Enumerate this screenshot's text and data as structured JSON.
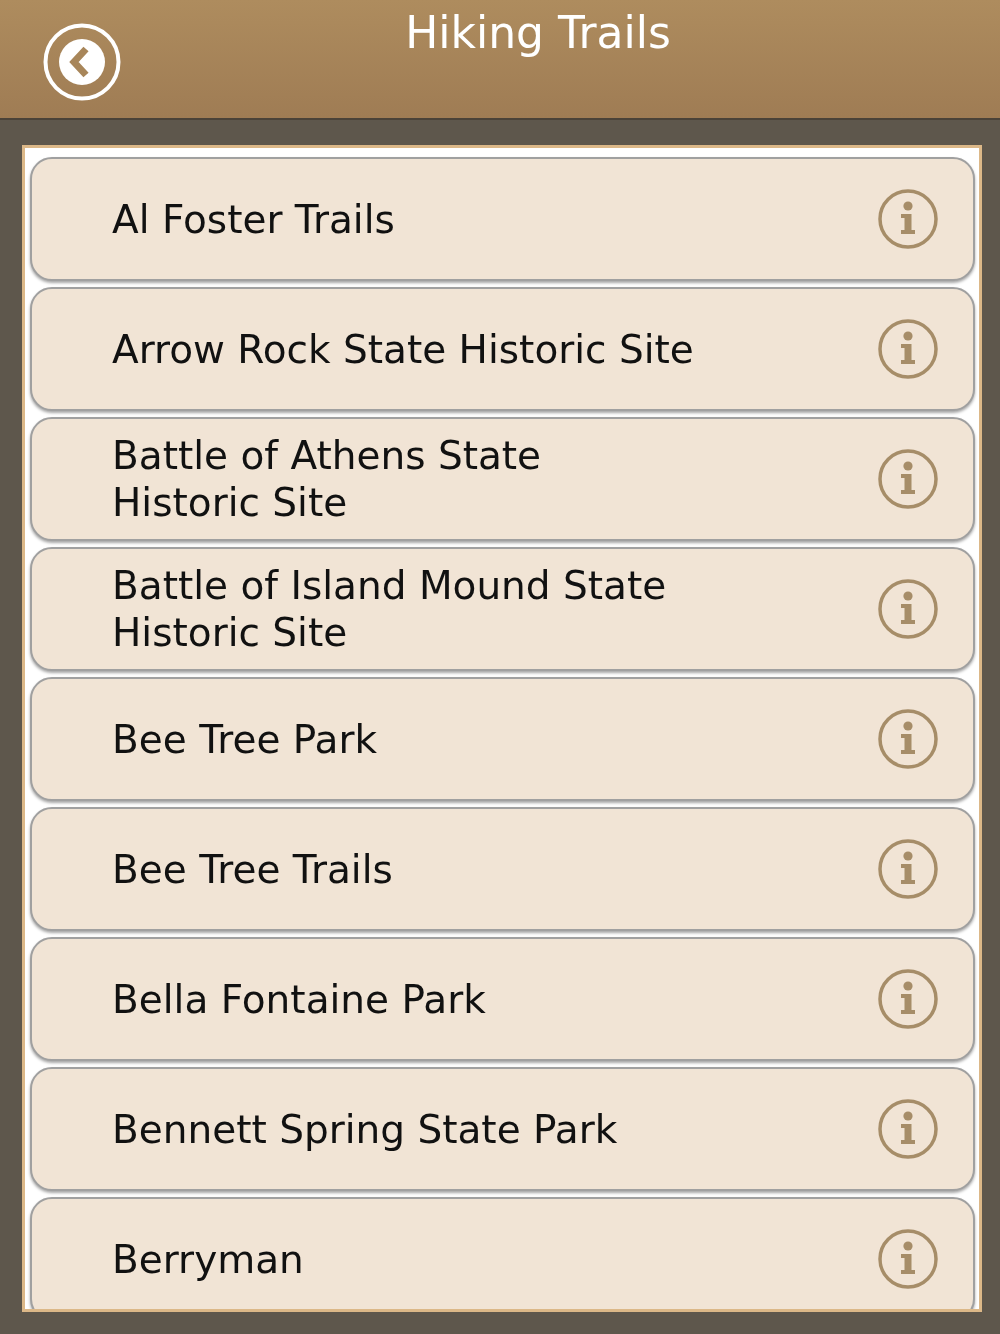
{
  "header": {
    "title": "Hiking Trails"
  },
  "trails": [
    {
      "name": "Al Foster Trails"
    },
    {
      "name": "Arrow Rock State Historic Site"
    },
    {
      "name": "Battle of Athens State Historic Site"
    },
    {
      "name": "Battle of Island Mound State Historic Site"
    },
    {
      "name": "Bee Tree Park"
    },
    {
      "name": "Bee Tree Trails"
    },
    {
      "name": "Bella Fontaine Park"
    },
    {
      "name": "Bennett Spring State Park"
    },
    {
      "name": "Berryman"
    }
  ]
}
